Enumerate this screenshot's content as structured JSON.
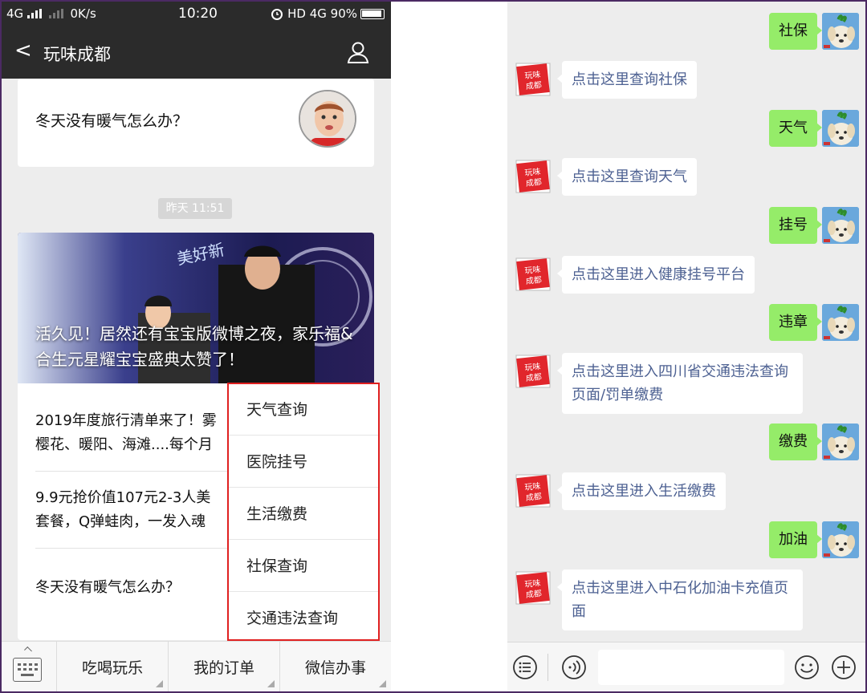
{
  "left": {
    "status": {
      "network": "4G",
      "speed": "0K/s",
      "time": "10:20",
      "right": "HD 4G 90%"
    },
    "nav": {
      "back": "<",
      "title": "玩味成都"
    },
    "card1": {
      "text": "冬天没有暖气怎么办？"
    },
    "timestamp": "昨天 11:51",
    "banner_title": "活久见！居然还有宝宝版微博之夜，家乐福&合生元星耀宝宝盛典太赞了！",
    "articles": [
      {
        "line1": "2019年度旅行清单来了！雾",
        "line2": "樱花、暖阳、海滩....每个月"
      },
      {
        "line1": "9.9元抢价值107元2-3人美",
        "line2": "套餐，Q弹蛙肉，一发入魂"
      },
      {
        "line1": "冬天没有暖气怎么办？",
        "line2": ""
      }
    ],
    "menu": [
      "天气查询",
      "医院挂号",
      "生活缴费",
      "社保查询",
      "交通违法查询"
    ],
    "bottom": [
      "吃喝玩乐",
      "我的订单",
      "微信办事"
    ]
  },
  "right": {
    "messages": [
      {
        "user": "社保",
        "reply": "点击这里查询社保"
      },
      {
        "user": "天气",
        "reply": "点击这里查询天气"
      },
      {
        "user": "挂号",
        "reply": "点击这里进入健康挂号平台"
      },
      {
        "user": "违章",
        "reply": "点击这里进入四川省交通违法查询页面/罚单缴费"
      },
      {
        "user": "缴费",
        "reply": "点击这里进入生活缴费"
      },
      {
        "user": "加油",
        "reply": "点击这里进入中石化加油卡充值页面"
      }
    ],
    "logo_text": "玩味成都"
  },
  "colors": {
    "nav_bg": "#2b2b2b",
    "user_bubble": "#95ec69",
    "link_text": "#4d6192",
    "highlight_border": "#e02020"
  }
}
